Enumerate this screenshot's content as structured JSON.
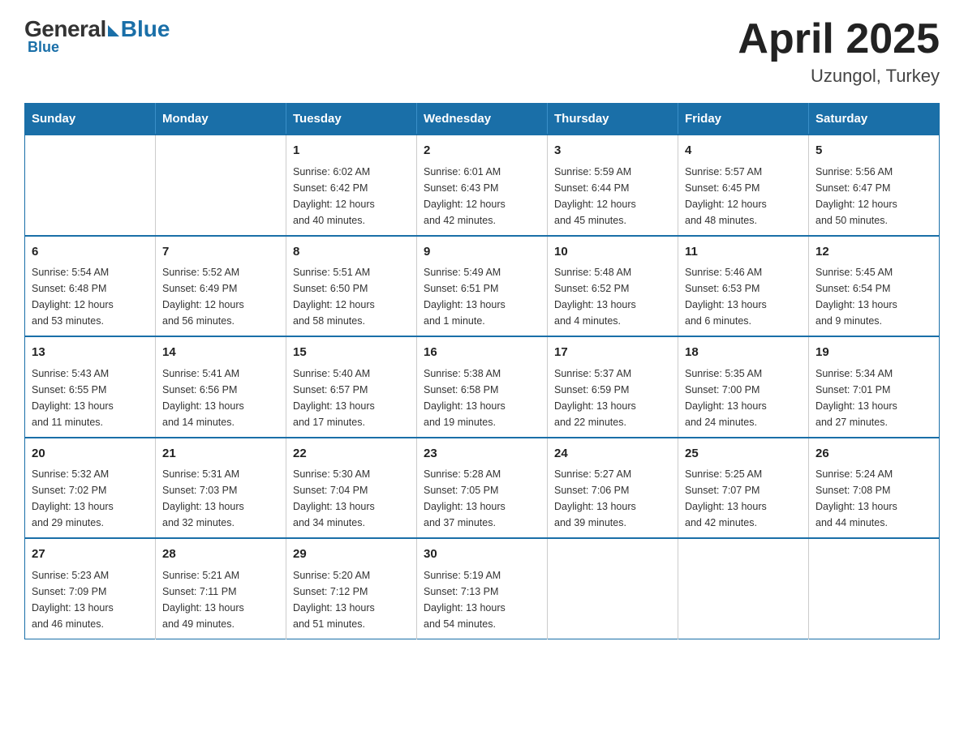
{
  "header": {
    "logo_general": "General",
    "logo_blue": "Blue",
    "title": "April 2025",
    "subtitle": "Uzungol, Turkey"
  },
  "days_of_week": [
    "Sunday",
    "Monday",
    "Tuesday",
    "Wednesday",
    "Thursday",
    "Friday",
    "Saturday"
  ],
  "weeks": [
    [
      {
        "day": "",
        "info": ""
      },
      {
        "day": "",
        "info": ""
      },
      {
        "day": "1",
        "info": "Sunrise: 6:02 AM\nSunset: 6:42 PM\nDaylight: 12 hours\nand 40 minutes."
      },
      {
        "day": "2",
        "info": "Sunrise: 6:01 AM\nSunset: 6:43 PM\nDaylight: 12 hours\nand 42 minutes."
      },
      {
        "day": "3",
        "info": "Sunrise: 5:59 AM\nSunset: 6:44 PM\nDaylight: 12 hours\nand 45 minutes."
      },
      {
        "day": "4",
        "info": "Sunrise: 5:57 AM\nSunset: 6:45 PM\nDaylight: 12 hours\nand 48 minutes."
      },
      {
        "day": "5",
        "info": "Sunrise: 5:56 AM\nSunset: 6:47 PM\nDaylight: 12 hours\nand 50 minutes."
      }
    ],
    [
      {
        "day": "6",
        "info": "Sunrise: 5:54 AM\nSunset: 6:48 PM\nDaylight: 12 hours\nand 53 minutes."
      },
      {
        "day": "7",
        "info": "Sunrise: 5:52 AM\nSunset: 6:49 PM\nDaylight: 12 hours\nand 56 minutes."
      },
      {
        "day": "8",
        "info": "Sunrise: 5:51 AM\nSunset: 6:50 PM\nDaylight: 12 hours\nand 58 minutes."
      },
      {
        "day": "9",
        "info": "Sunrise: 5:49 AM\nSunset: 6:51 PM\nDaylight: 13 hours\nand 1 minute."
      },
      {
        "day": "10",
        "info": "Sunrise: 5:48 AM\nSunset: 6:52 PM\nDaylight: 13 hours\nand 4 minutes."
      },
      {
        "day": "11",
        "info": "Sunrise: 5:46 AM\nSunset: 6:53 PM\nDaylight: 13 hours\nand 6 minutes."
      },
      {
        "day": "12",
        "info": "Sunrise: 5:45 AM\nSunset: 6:54 PM\nDaylight: 13 hours\nand 9 minutes."
      }
    ],
    [
      {
        "day": "13",
        "info": "Sunrise: 5:43 AM\nSunset: 6:55 PM\nDaylight: 13 hours\nand 11 minutes."
      },
      {
        "day": "14",
        "info": "Sunrise: 5:41 AM\nSunset: 6:56 PM\nDaylight: 13 hours\nand 14 minutes."
      },
      {
        "day": "15",
        "info": "Sunrise: 5:40 AM\nSunset: 6:57 PM\nDaylight: 13 hours\nand 17 minutes."
      },
      {
        "day": "16",
        "info": "Sunrise: 5:38 AM\nSunset: 6:58 PM\nDaylight: 13 hours\nand 19 minutes."
      },
      {
        "day": "17",
        "info": "Sunrise: 5:37 AM\nSunset: 6:59 PM\nDaylight: 13 hours\nand 22 minutes."
      },
      {
        "day": "18",
        "info": "Sunrise: 5:35 AM\nSunset: 7:00 PM\nDaylight: 13 hours\nand 24 minutes."
      },
      {
        "day": "19",
        "info": "Sunrise: 5:34 AM\nSunset: 7:01 PM\nDaylight: 13 hours\nand 27 minutes."
      }
    ],
    [
      {
        "day": "20",
        "info": "Sunrise: 5:32 AM\nSunset: 7:02 PM\nDaylight: 13 hours\nand 29 minutes."
      },
      {
        "day": "21",
        "info": "Sunrise: 5:31 AM\nSunset: 7:03 PM\nDaylight: 13 hours\nand 32 minutes."
      },
      {
        "day": "22",
        "info": "Sunrise: 5:30 AM\nSunset: 7:04 PM\nDaylight: 13 hours\nand 34 minutes."
      },
      {
        "day": "23",
        "info": "Sunrise: 5:28 AM\nSunset: 7:05 PM\nDaylight: 13 hours\nand 37 minutes."
      },
      {
        "day": "24",
        "info": "Sunrise: 5:27 AM\nSunset: 7:06 PM\nDaylight: 13 hours\nand 39 minutes."
      },
      {
        "day": "25",
        "info": "Sunrise: 5:25 AM\nSunset: 7:07 PM\nDaylight: 13 hours\nand 42 minutes."
      },
      {
        "day": "26",
        "info": "Sunrise: 5:24 AM\nSunset: 7:08 PM\nDaylight: 13 hours\nand 44 minutes."
      }
    ],
    [
      {
        "day": "27",
        "info": "Sunrise: 5:23 AM\nSunset: 7:09 PM\nDaylight: 13 hours\nand 46 minutes."
      },
      {
        "day": "28",
        "info": "Sunrise: 5:21 AM\nSunset: 7:11 PM\nDaylight: 13 hours\nand 49 minutes."
      },
      {
        "day": "29",
        "info": "Sunrise: 5:20 AM\nSunset: 7:12 PM\nDaylight: 13 hours\nand 51 minutes."
      },
      {
        "day": "30",
        "info": "Sunrise: 5:19 AM\nSunset: 7:13 PM\nDaylight: 13 hours\nand 54 minutes."
      },
      {
        "day": "",
        "info": ""
      },
      {
        "day": "",
        "info": ""
      },
      {
        "day": "",
        "info": ""
      }
    ]
  ]
}
